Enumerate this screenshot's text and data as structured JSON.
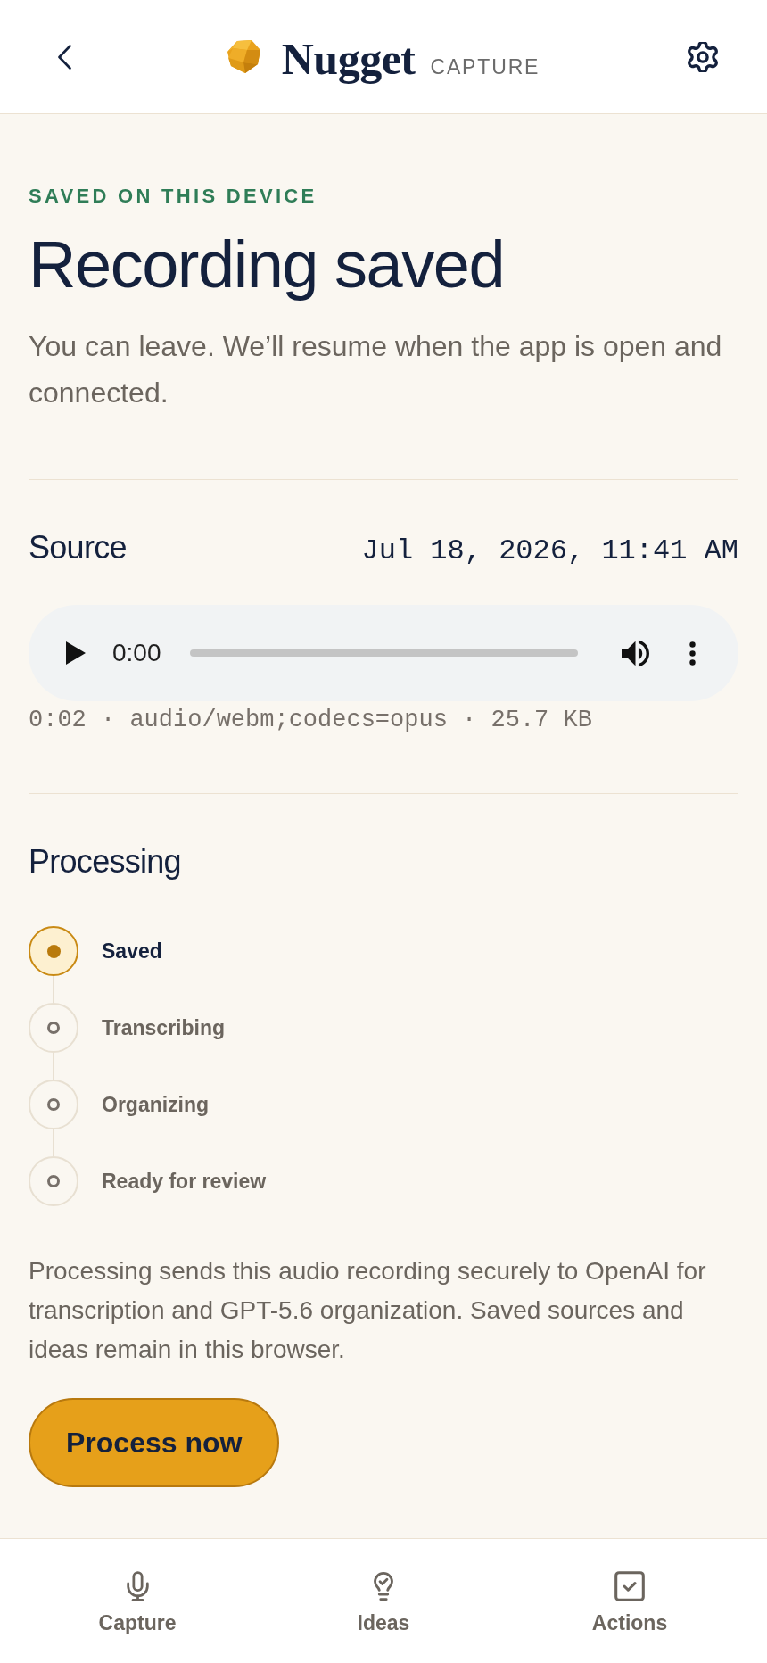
{
  "header": {
    "brand": "Nugget",
    "section": "CAPTURE"
  },
  "status": {
    "eyebrow": "SAVED ON THIS DEVICE",
    "title": "Recording saved",
    "message": "You can leave. We’ll resume when the app is open and connected."
  },
  "source": {
    "heading": "Source",
    "timestamp": "Jul 18, 2026, 11:41 AM",
    "player": {
      "time": "0:00",
      "level": 0
    },
    "file_info": "0:02 · audio/webm;codecs=opus · 25.7 KB"
  },
  "processing": {
    "heading": "Processing",
    "steps": [
      {
        "label": "Saved",
        "active": true
      },
      {
        "label": "Transcribing",
        "active": false
      },
      {
        "label": "Organizing",
        "active": false
      },
      {
        "label": "Ready for review",
        "active": false
      }
    ],
    "note": "Processing sends this audio recording securely to OpenAI for transcription and GPT-5.6 organization. Saved sources and ideas remain in this browser.",
    "button": "Process now"
  },
  "nav": [
    {
      "label": "Capture"
    },
    {
      "label": "Ideas"
    },
    {
      "label": "Actions"
    }
  ]
}
